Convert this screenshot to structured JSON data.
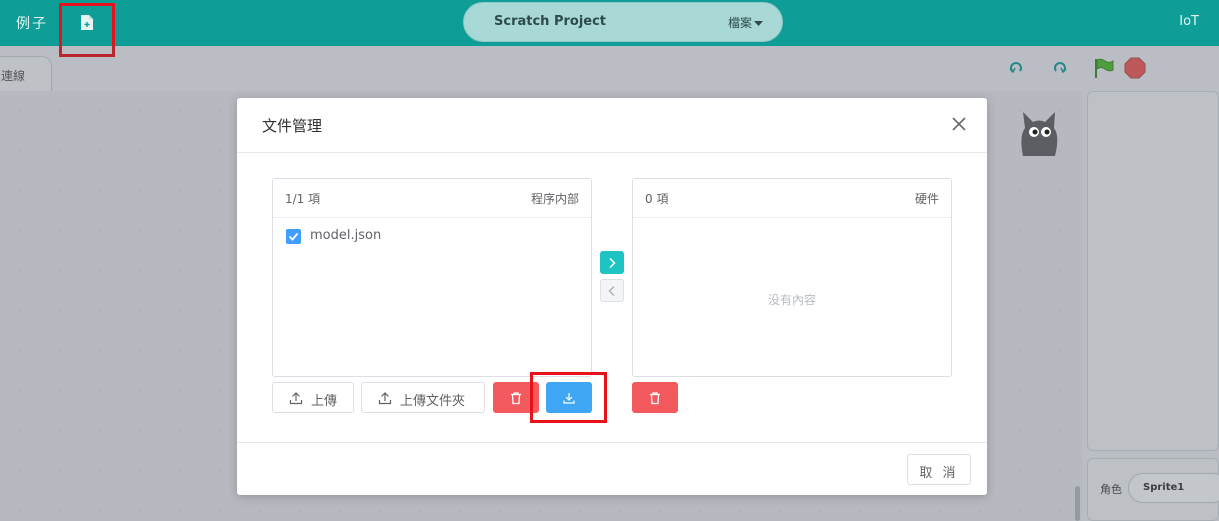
{
  "app": {
    "examples_menu": "例子",
    "project_title": "Scratch Project",
    "file_menu": "檔案",
    "iot_label": "IoT",
    "connect_tab": "連線",
    "sprite_label": "角色",
    "sprite_name": "Sprite1"
  },
  "modal": {
    "title": "文件管理",
    "left_panel": {
      "count": "1/1 項",
      "title": "程序内部",
      "items": [
        {
          "name": "model.json",
          "checked": true
        }
      ]
    },
    "right_panel": {
      "count": "0 項",
      "title": "硬件",
      "empty_text": "没有內容"
    },
    "buttons": {
      "upload": "上傳",
      "upload_folder": "上傳文件夾"
    },
    "cancel": "取 消"
  },
  "colors": {
    "topbar": "#0e9e97",
    "primary": "#3fa7f5",
    "danger": "#f25a5e",
    "transfer_active": "#1ec3c3",
    "highlight": "#e8131a"
  },
  "icons": {
    "file": "file-icon",
    "close": "close-icon",
    "upload": "upload-icon",
    "delete": "trash-icon",
    "download": "download-icon",
    "arrow_right": "chevron-right-icon",
    "arrow_left": "chevron-left-icon",
    "green_flag": "green-flag-icon",
    "stop": "stop-icon"
  }
}
